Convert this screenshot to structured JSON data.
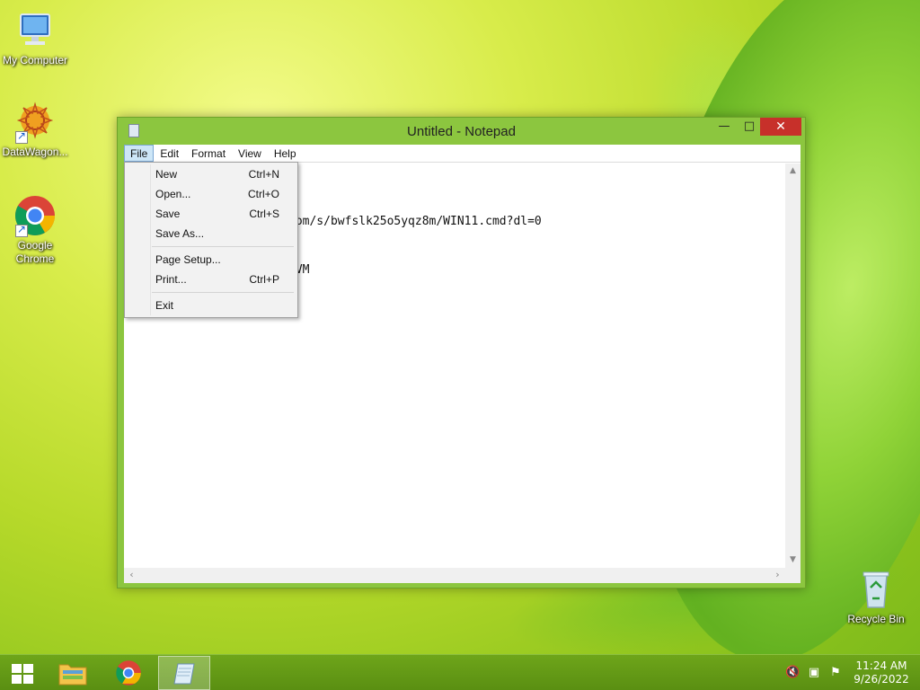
{
  "desktop": {
    "icons": [
      {
        "label": "My Computer",
        "icon": "computer-icon"
      },
      {
        "label": "DataWagon...",
        "icon": "datawagon-icon"
      },
      {
        "label": "Google Chrome",
        "icon": "chrome-icon"
      },
      {
        "label": "Recycle Bin",
        "icon": "recycle-bin-icon"
      }
    ]
  },
  "window": {
    "title": "Untitled - Notepad",
    "buttons": {
      "minimize": "—",
      "maximize": "□",
      "close": "✕"
    }
  },
  "menubar": {
    "items": [
      "File",
      "Edit",
      "Format",
      "View",
      "Help"
    ],
    "active": "File"
  },
  "editor": {
    "lines": [
      "",
      "",
      "",
      "com/s/bwfslk25o5yqz8m/WIN11.cmd?dl=0",
      "",
      "",
      "oVM"
    ]
  },
  "file_menu": {
    "items": [
      {
        "label": "New",
        "shortcut": "Ctrl+N"
      },
      {
        "label": "Open...",
        "shortcut": "Ctrl+O"
      },
      {
        "label": "Save",
        "shortcut": "Ctrl+S"
      },
      {
        "label": "Save As...",
        "shortcut": ""
      },
      {
        "label": "Page Setup...",
        "shortcut": ""
      },
      {
        "label": "Print...",
        "shortcut": "Ctrl+P"
      },
      {
        "label": "Exit",
        "shortcut": ""
      }
    ]
  },
  "taskbar": {
    "items": [
      "start-button",
      "file-explorer",
      "google-chrome",
      "notepad"
    ],
    "active": "notepad",
    "clock": {
      "time": "11:24 AM",
      "date": "9/26/2022"
    },
    "tray_icons": [
      "volume-muted-icon",
      "network-icon",
      "action-center-icon"
    ]
  },
  "colors": {
    "window_frame": "#8cc63f",
    "close_button": "#c7302a",
    "taskbar": "#5a8f12",
    "menu_highlight": "#cde6f7"
  }
}
